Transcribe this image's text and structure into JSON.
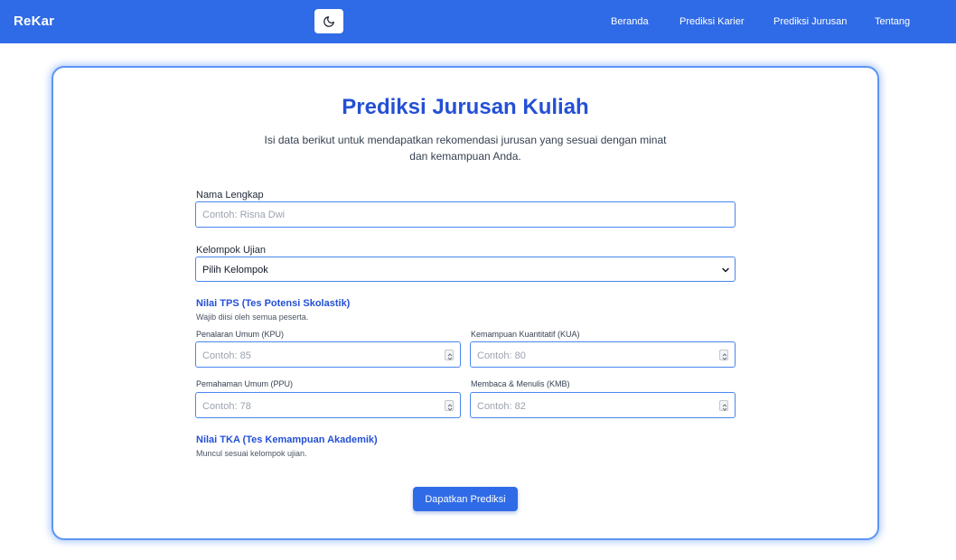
{
  "colors": {
    "brand": "#2f6be6",
    "title": "#2450d6",
    "border": "#4a86ef"
  },
  "nav": {
    "brand": "ReKar",
    "theme_icon": "moon-icon",
    "links": [
      "Beranda",
      "Prediksi Karier",
      "Prediksi Jurusan",
      "Tentang"
    ]
  },
  "page": {
    "title": "Prediksi Jurusan Kuliah",
    "description": "Isi data berikut untuk mendapatkan rekomendasi jurusan yang sesuai dengan minat dan kemampuan Anda."
  },
  "form": {
    "name": {
      "label": "Nama Lengkap",
      "placeholder": "Contoh: Risna Dwi",
      "value": ""
    },
    "group": {
      "label": "Kelompok Ujian",
      "selected": "Pilih Kelompok"
    },
    "tps": {
      "title": "Nilai TPS (Tes Potensi Skolastik)",
      "note": "Wajib diisi oleh semua peserta.",
      "fields": [
        {
          "label": "Penalaran Umum (KPU)",
          "placeholder": "Contoh: 85"
        },
        {
          "label": "Kemampuan Kuantitatif (KUA)",
          "placeholder": "Contoh: 80"
        },
        {
          "label": "Pemahaman Umum (PPU)",
          "placeholder": "Contoh: 78"
        },
        {
          "label": "Membaca & Menulis (KMB)",
          "placeholder": "Contoh: 82"
        }
      ]
    },
    "tka": {
      "title": "Nilai TKA (Tes Kemampuan Akademik)",
      "note": "Muncul sesuai kelompok ujian."
    },
    "submit_label": "Dapatkan Prediksi"
  }
}
